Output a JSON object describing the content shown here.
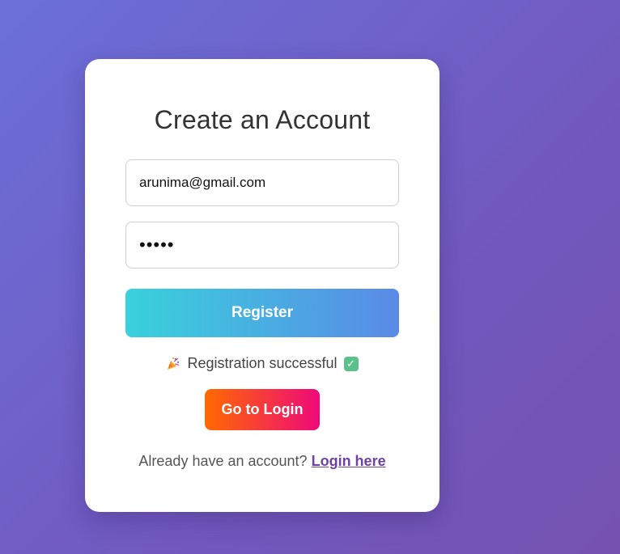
{
  "form": {
    "title": "Create an Account",
    "email_value": "arunima@gmail.com",
    "password_value": "12345",
    "register_label": "Register",
    "status_text": "Registration successful",
    "status_leading_icon": "party-popper-icon",
    "status_trailing_icon": "check-mark-icon",
    "go_to_login_label": "Go to Login",
    "footer_text": "Already have an account?",
    "login_link_label": "Login here"
  },
  "colors": {
    "background_start": "#6b70d9",
    "background_end": "#7552b0",
    "register_gradient_start": "#38d2dc",
    "register_gradient_end": "#5a8ae6",
    "login_gradient_start": "#ff6a00",
    "login_gradient_end": "#ee0979",
    "link_color": "#6f42a1",
    "check_color": "#5cc08a"
  }
}
